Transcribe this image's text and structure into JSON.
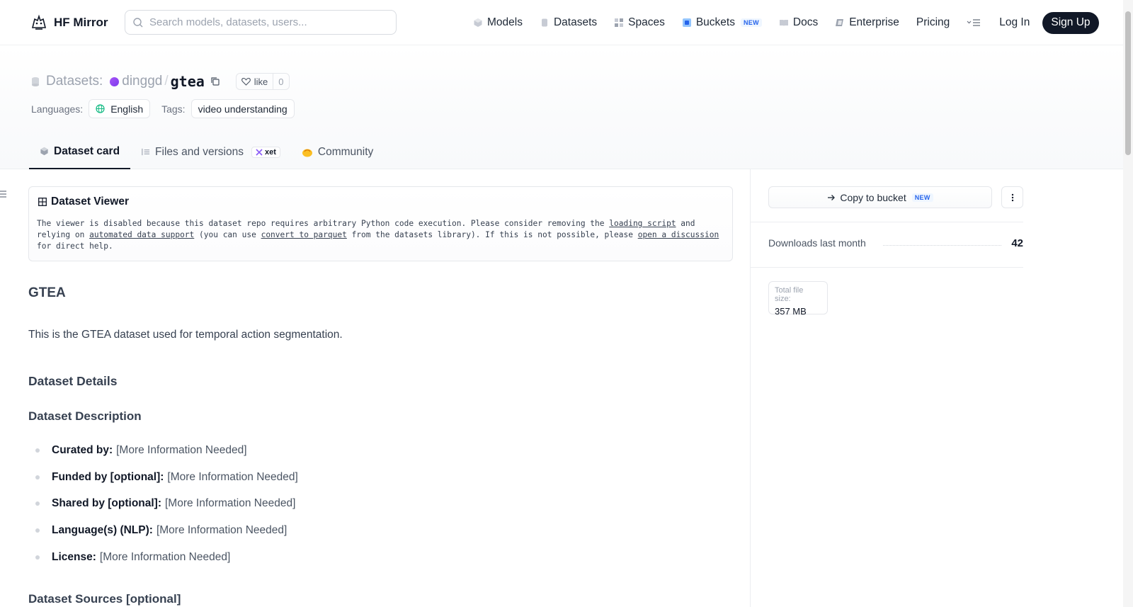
{
  "nav": {
    "brand": "HF Mirror",
    "search_placeholder": "Search models, datasets, users...",
    "links": {
      "models": "Models",
      "datasets": "Datasets",
      "spaces": "Spaces",
      "buckets": "Buckets",
      "buckets_badge": "NEW",
      "docs": "Docs",
      "enterprise": "Enterprise",
      "pricing": "Pricing"
    },
    "login": "Log In",
    "signup": "Sign Up"
  },
  "header": {
    "type_label": "Datasets:",
    "owner": "dinggd",
    "repo": "gtea",
    "like_label": "like",
    "like_count": "0",
    "languages_label": "Languages:",
    "language": "English",
    "tags_label": "Tags:",
    "tag": "video understanding",
    "tabs": {
      "card": "Dataset card",
      "files": "Files and versions",
      "xet": "xet",
      "community": "Community"
    }
  },
  "viewer": {
    "title": "Dataset Viewer",
    "msg_1": "The viewer is disabled because this dataset repo requires arbitrary Python code execution. Please consider removing the ",
    "link_loading": "loading script",
    "msg_2": " and relying on ",
    "link_auto": "automated data support",
    "msg_3": " (you can use ",
    "link_parquet": "convert to parquet",
    "msg_4": " from the datasets library). If this is not possible, please ",
    "link_discussion": "open a discussion",
    "msg_5": " for direct help."
  },
  "content": {
    "h_gtea": "GTEA",
    "intro": "This is the GTEA dataset used for temporal action segmentation.",
    "h_details": "Dataset Details",
    "h_description": "Dataset Description",
    "items": [
      {
        "label": "Curated by:",
        "value": "[More Information Needed]"
      },
      {
        "label": "Funded by [optional]:",
        "value": "[More Information Needed]"
      },
      {
        "label": "Shared by [optional]:",
        "value": "[More Information Needed]"
      },
      {
        "label": "Language(s) (NLP):",
        "value": "[More Information Needed]"
      },
      {
        "label": "License:",
        "value": "[More Information Needed]"
      }
    ],
    "h_sources": "Dataset Sources [optional]"
  },
  "sidebar": {
    "copy_bucket": "Copy to bucket",
    "copy_badge": "NEW",
    "downloads_label": "Downloads last month",
    "downloads": "42",
    "filesize_label": "Total file size:",
    "filesize": "357 MB"
  }
}
